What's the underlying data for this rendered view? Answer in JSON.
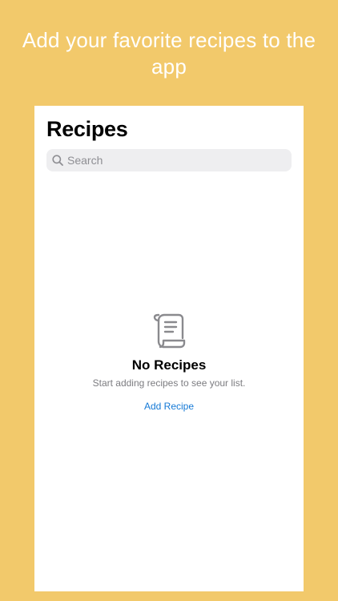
{
  "promo": {
    "headline": "Add your favorite recipes to the app"
  },
  "screen": {
    "title": "Recipes",
    "search": {
      "placeholder": "Search",
      "icon": "magnifying-glass"
    },
    "empty_state": {
      "icon": "scroll",
      "title": "No Recipes",
      "subtitle": "Start adding recipes to see your list.",
      "action_label": "Add Recipe"
    }
  },
  "colors": {
    "background": "#F2C96B",
    "accent": "#1479D6",
    "search_field": "#EEEEF0",
    "secondary_text": "#8E8E93"
  }
}
